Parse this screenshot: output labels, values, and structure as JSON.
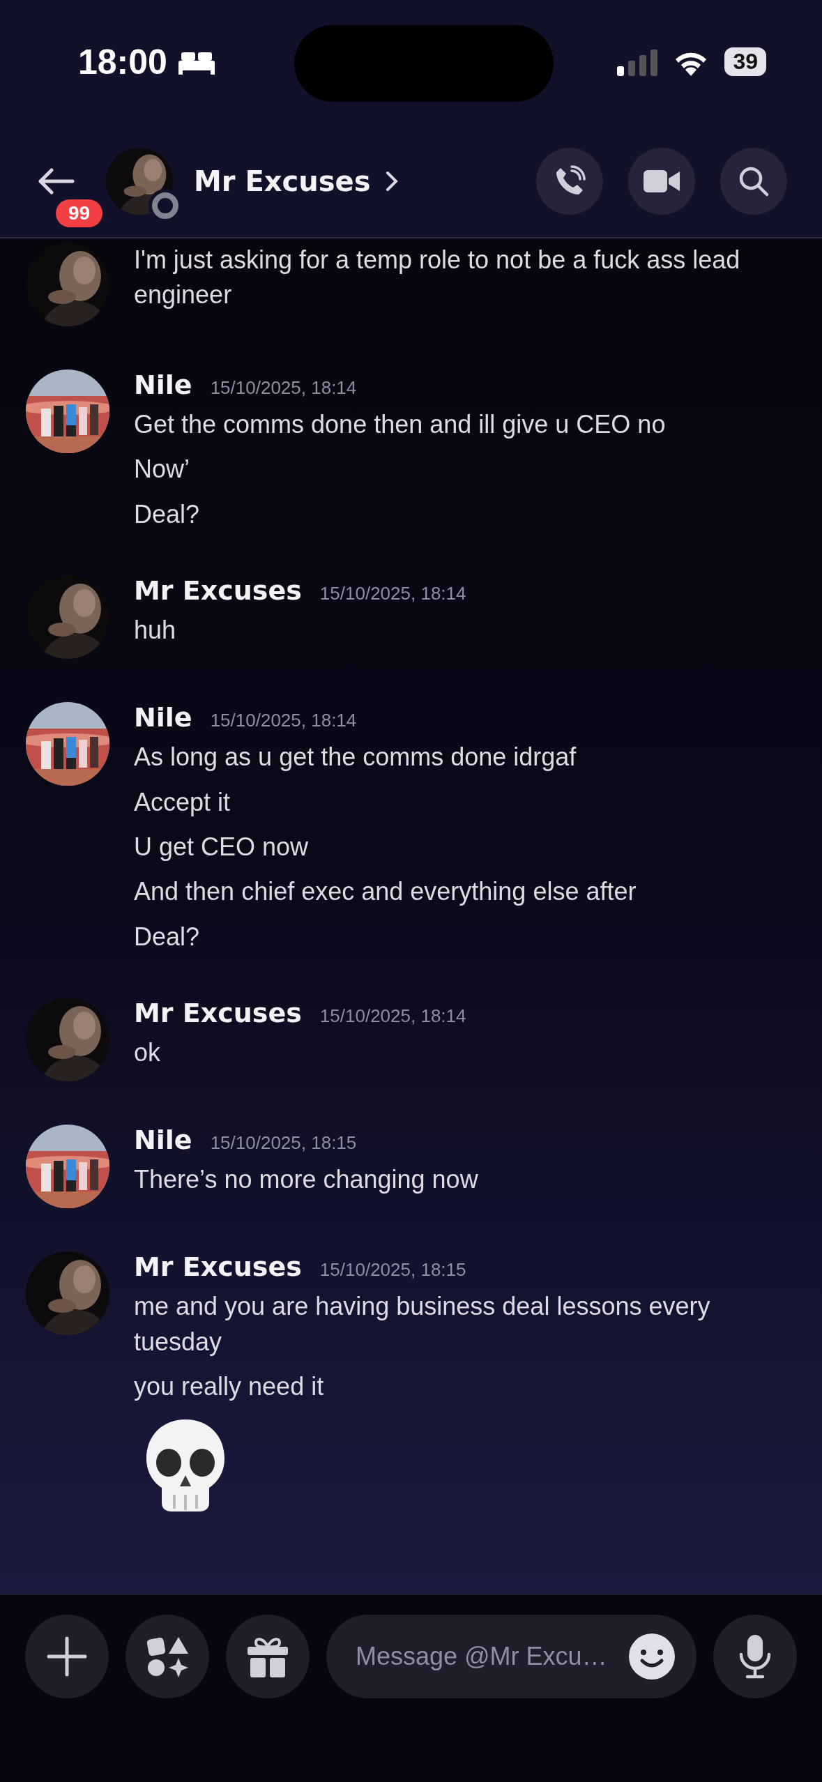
{
  "status_bar": {
    "time": "18:00",
    "battery": "39"
  },
  "header": {
    "unread_badge": "99",
    "contact": "Mr Excuses"
  },
  "messages": [
    {
      "lines": [
        {
          "kind": "text",
          "text": "I'm just asking for a temp role to not be a fuck ass lead engineer"
        }
      ]
    },
    {
      "author": "Nile",
      "time": "15/10/2025, 18:14",
      "lines": [
        {
          "kind": "text",
          "text": "Get the comms done then and ill give u CEO no"
        },
        {
          "kind": "text",
          "text": "Now’"
        },
        {
          "kind": "text",
          "text": "Deal?"
        }
      ]
    },
    {
      "author": "Mr Excuses",
      "time": "15/10/2025, 18:14",
      "lines": [
        {
          "kind": "text",
          "text": "huh"
        }
      ]
    },
    {
      "author": "Nile",
      "time": "15/10/2025, 18:14",
      "lines": [
        {
          "kind": "text",
          "text": "As long as u get the comms done idrgaf"
        },
        {
          "kind": "text",
          "text": "Accept it"
        },
        {
          "kind": "text",
          "text": "U get CEO now"
        },
        {
          "kind": "text",
          "text": "And then chief exec and everything else after"
        },
        {
          "kind": "text",
          "text": "Deal?"
        }
      ]
    },
    {
      "author": "Mr Excuses",
      "time": "15/10/2025, 18:14",
      "lines": [
        {
          "kind": "text",
          "text": "ok"
        }
      ]
    },
    {
      "author": "Nile",
      "time": "15/10/2025, 18:15",
      "lines": [
        {
          "kind": "text",
          "text": "There’s no more changing now"
        }
      ]
    },
    {
      "author": "Mr Excuses",
      "time": "15/10/2025, 18:15",
      "lines": [
        {
          "kind": "text",
          "text": "me and you are having business deal lessons every tuesday"
        },
        {
          "kind": "text",
          "text": "you really need it"
        },
        {
          "kind": "skull-emoji"
        }
      ]
    }
  ],
  "composer": {
    "placeholder": "Message @Mr Excu…"
  }
}
